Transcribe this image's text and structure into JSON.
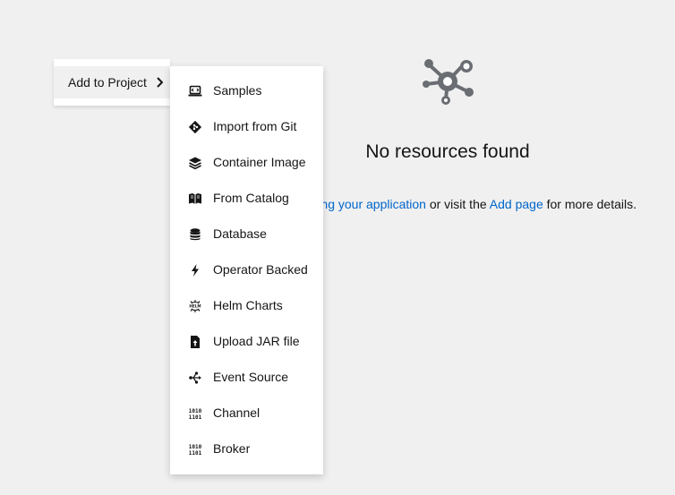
{
  "empty_state": {
    "title": "No resources found",
    "text_link_1": "ng your application",
    "text_mid": "or visit the",
    "text_link_2": "Add page",
    "text_end": "for more details."
  },
  "menu": {
    "add_to_project_label": "Add to Project",
    "items": [
      {
        "label": "Samples",
        "icon": "laptop-code-icon"
      },
      {
        "label": "Import from Git",
        "icon": "git-icon"
      },
      {
        "label": "Container Image",
        "icon": "layers-icon"
      },
      {
        "label": "From Catalog",
        "icon": "book-catalog-icon"
      },
      {
        "label": "Database",
        "icon": "database-icon"
      },
      {
        "label": "Operator Backed",
        "icon": "bolt-icon"
      },
      {
        "label": "Helm Charts",
        "icon": "helm-icon"
      },
      {
        "label": "Upload JAR file",
        "icon": "file-upload-icon"
      },
      {
        "label": "Event Source",
        "icon": "event-source-icon"
      },
      {
        "label": "Channel",
        "icon": "channel-icon"
      },
      {
        "label": "Broker",
        "icon": "broker-icon"
      }
    ]
  },
  "colors": {
    "background": "#f0f0f0",
    "link": "#0066cc",
    "icon_gray": "#6a6e73",
    "text": "#151515"
  }
}
